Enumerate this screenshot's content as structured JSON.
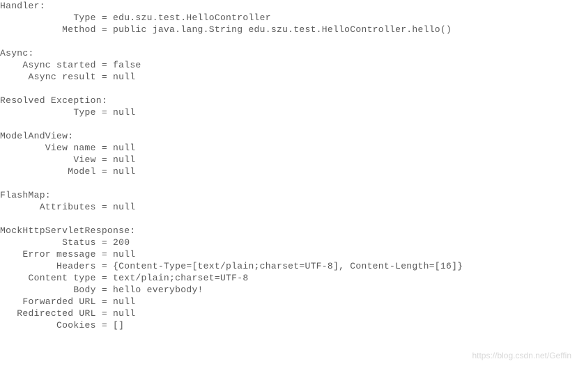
{
  "lines": [
    "Handler:",
    "             Type = edu.szu.test.HelloController",
    "           Method = public java.lang.String edu.szu.test.HelloController.hello()",
    "",
    "Async:",
    "    Async started = false",
    "     Async result = null",
    "",
    "Resolved Exception:",
    "             Type = null",
    "",
    "ModelAndView:",
    "        View name = null",
    "             View = null",
    "            Model = null",
    "",
    "FlashMap:",
    "       Attributes = null",
    "",
    "MockHttpServletResponse:",
    "           Status = 200",
    "    Error message = null",
    "          Headers = {Content-Type=[text/plain;charset=UTF-8], Content-Length=[16]}",
    "     Content type = text/plain;charset=UTF-8",
    "             Body = hello everybody!",
    "    Forwarded URL = null",
    "   Redirected URL = null",
    "          Cookies = []"
  ],
  "watermark": "https://blog.csdn.net/Geffin"
}
